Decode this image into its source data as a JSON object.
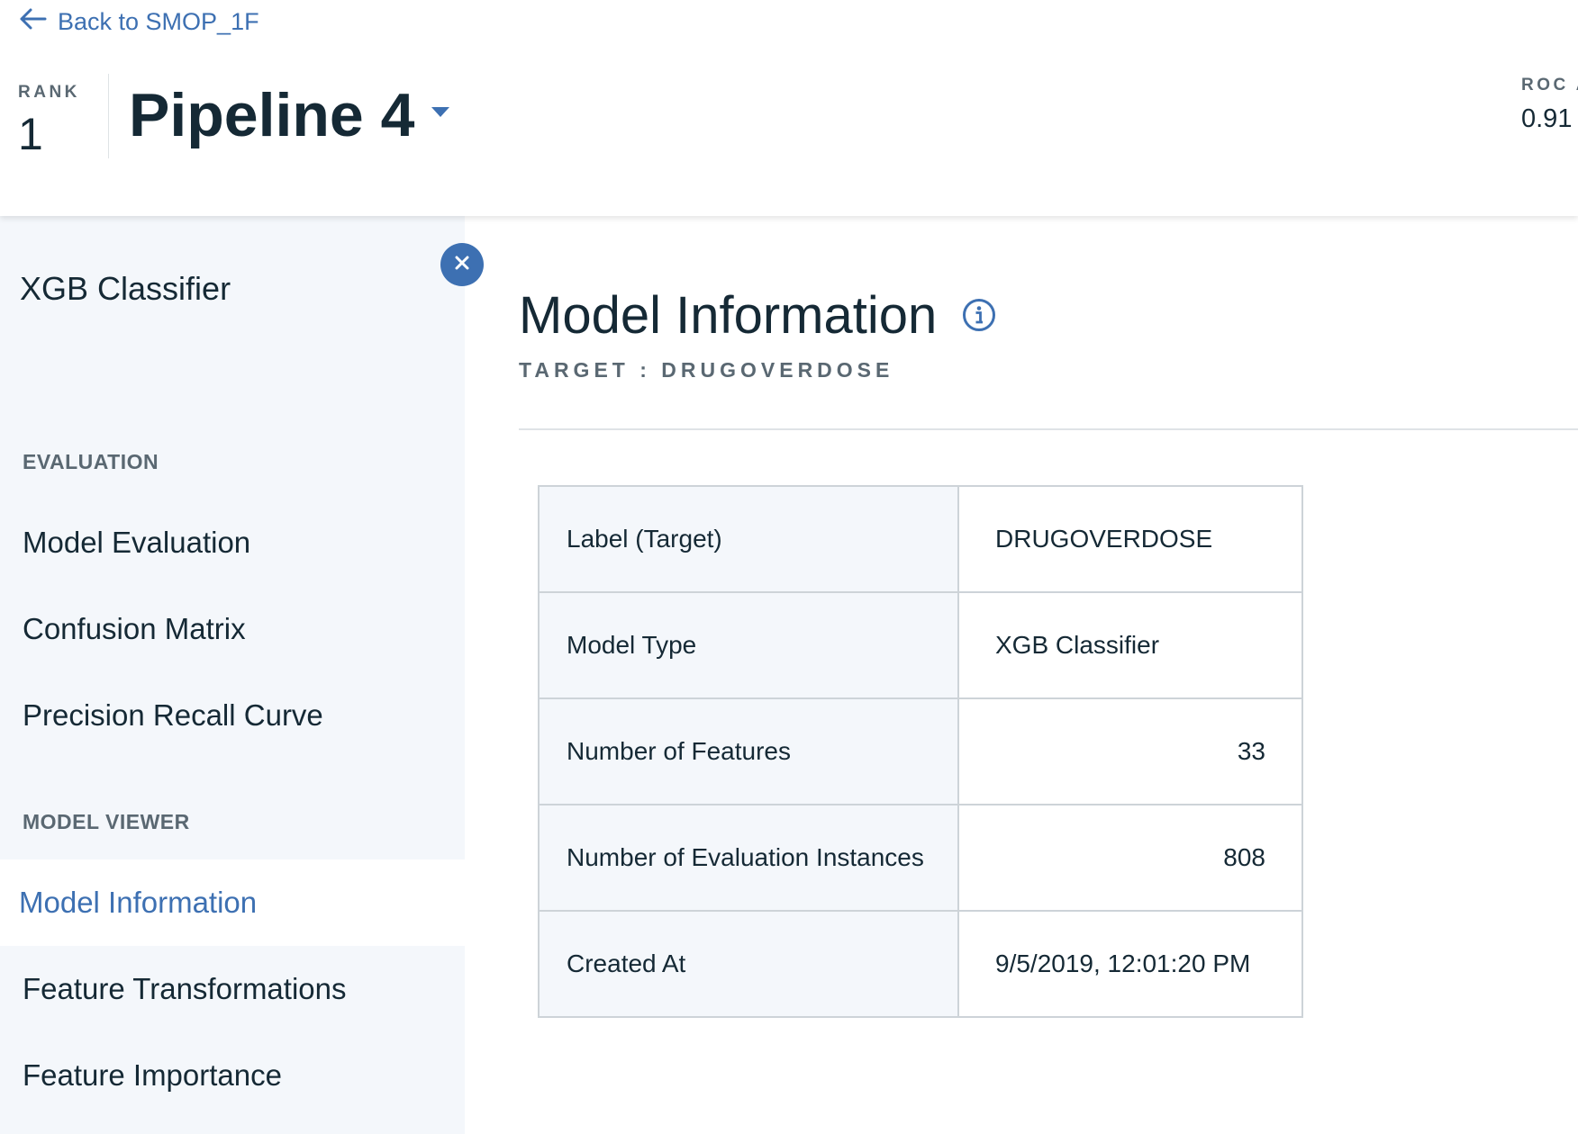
{
  "header": {
    "back_label": "Back to SMOP_1F",
    "rank_label": "RANK",
    "rank_value": "1",
    "pipeline_title": "Pipeline 4",
    "metric_label": "ROC A",
    "metric_value": "0.91"
  },
  "sidebar": {
    "model_name": "XGB Classifier",
    "sections": [
      {
        "label": "EVALUATION",
        "items": [
          {
            "label": "Model Evaluation"
          },
          {
            "label": "Confusion Matrix"
          },
          {
            "label": "Precision Recall Curve"
          }
        ]
      },
      {
        "label": "MODEL VIEWER",
        "items": [
          {
            "label": "Model Information",
            "active": true
          },
          {
            "label": "Feature Transformations"
          },
          {
            "label": "Feature Importance"
          }
        ]
      }
    ]
  },
  "main": {
    "title": "Model Information",
    "target_line": "TARGET : DRUGOVERDOSE",
    "table": [
      {
        "key": "Label (Target)",
        "value": "DRUGOVERDOSE"
      },
      {
        "key": "Model Type",
        "value": "XGB Classifier"
      },
      {
        "key": "Number of Features",
        "value": "33"
      },
      {
        "key": "Number of Evaluation Instances",
        "value": "808"
      },
      {
        "key": "Created At",
        "value": "9/5/2019, 12:01:20 PM"
      }
    ]
  },
  "colors": {
    "accent": "#3d70b2",
    "text": "#152935",
    "muted": "#5a6872",
    "sidebar_bg": "#f4f7fb"
  },
  "icons": {
    "back": "arrow-left-icon",
    "dropdown": "caret-down-icon",
    "close": "close-icon",
    "info": "info-icon"
  }
}
